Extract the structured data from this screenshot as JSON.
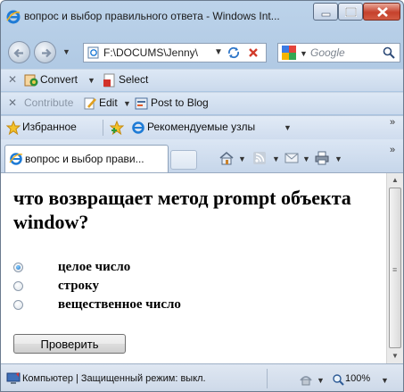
{
  "window": {
    "title": "вопрос и выбор правильного ответа - Windows Int..."
  },
  "navigation": {
    "address": "F:\\DOCUMS\\Jenny\\",
    "search_placeholder": "Google"
  },
  "toolbar_convert": {
    "convert_label": "Convert",
    "select_label": "Select"
  },
  "toolbar_blog": {
    "contribute_label": "Contribute",
    "edit_label": "Edit",
    "post_label": "Post to Blog"
  },
  "favorites": {
    "favorites_label": "Избранное",
    "recommended_label": "Рекомендуемые узлы"
  },
  "tab": {
    "label": "вопрос и выбор прави..."
  },
  "page": {
    "question": "что возвращает метод prompt объекта window?",
    "options": [
      {
        "label": "целое число",
        "checked": true
      },
      {
        "label": "строку",
        "checked": false
      },
      {
        "label": "вещественное число",
        "checked": false
      }
    ],
    "check_button": "Проверить"
  },
  "status": {
    "text": "Компьютер | Защищенный режим: выкл.",
    "zoom": "100%"
  },
  "colors": {
    "accent": "#1f6fc2",
    "close_button": "#c6412c"
  }
}
